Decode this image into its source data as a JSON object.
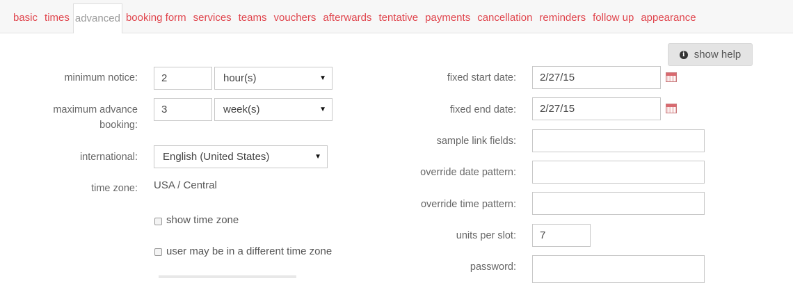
{
  "tabs": [
    {
      "label": "basic",
      "active": false
    },
    {
      "label": "times",
      "active": false
    },
    {
      "label": "advanced",
      "active": true
    },
    {
      "label": "booking form",
      "active": false
    },
    {
      "label": "services",
      "active": false
    },
    {
      "label": "teams",
      "active": false
    },
    {
      "label": "vouchers",
      "active": false
    },
    {
      "label": "afterwards",
      "active": false
    },
    {
      "label": "tentative",
      "active": false
    },
    {
      "label": "payments",
      "active": false
    },
    {
      "label": "cancellation",
      "active": false
    },
    {
      "label": "reminders",
      "active": false
    },
    {
      "label": "follow up",
      "active": false
    },
    {
      "label": "appearance",
      "active": false
    }
  ],
  "help_button": {
    "label": "show help",
    "icon": "info-icon"
  },
  "left": {
    "minimum_notice": {
      "label": "minimum notice:",
      "value": "2",
      "unit": "hour(s)"
    },
    "maximum_advance": {
      "label": "maximum advance booking:",
      "value": "3",
      "unit": "week(s)"
    },
    "international": {
      "label": "international:",
      "value": "English (United States)"
    },
    "time_zone": {
      "label": "time zone:",
      "value": "USA / Central"
    },
    "show_time_zone": {
      "label": "show time zone",
      "checked": false
    },
    "different_time_zone": {
      "label": "user may be in a different time zone",
      "checked": false
    }
  },
  "right": {
    "fixed_start_date": {
      "label": "fixed start date:",
      "value": "2/27/15"
    },
    "fixed_end_date": {
      "label": "fixed end date:",
      "value": "2/27/15"
    },
    "sample_link_fields": {
      "label": "sample link fields:",
      "value": ""
    },
    "override_date_pattern": {
      "label": "override date pattern:",
      "value": ""
    },
    "override_time_pattern": {
      "label": "override time pattern:",
      "value": ""
    },
    "units_per_slot": {
      "label": "units per slot:",
      "value": "7"
    },
    "password": {
      "label": "password:",
      "value": ""
    }
  },
  "colors": {
    "tab_link": "#e0454d",
    "tab_active": "#9a9a9a",
    "label": "#666666"
  }
}
